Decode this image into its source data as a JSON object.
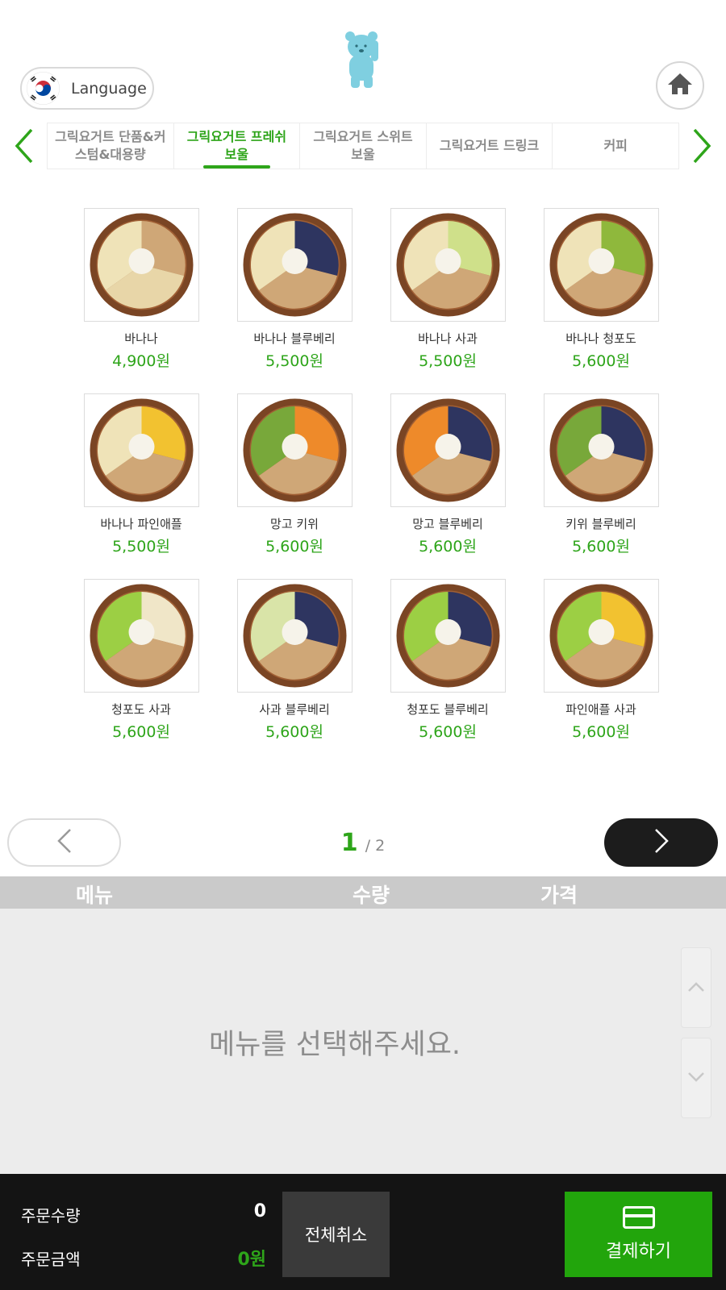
{
  "header": {
    "language_label": "Language",
    "language_flag": "korea-flag-icon",
    "logo": "bear-mascot-logo",
    "home_icon": "home-icon"
  },
  "categories": {
    "prev_icon": "chevron-left-icon",
    "next_icon": "chevron-right-icon",
    "tabs": [
      {
        "label": "그릭요거트 단품&커스텀&대용량",
        "active": false
      },
      {
        "label": "그릭요거트 프레쉬 보울",
        "active": true
      },
      {
        "label": "그릭요거트 스위트 보울",
        "active": false
      },
      {
        "label": "그릭요거트 드링크",
        "active": false
      },
      {
        "label": "커피",
        "active": false
      }
    ]
  },
  "products": [
    {
      "name": "바나나",
      "price": "4,900원"
    },
    {
      "name": "바나나 블루베리",
      "price": "5,500원"
    },
    {
      "name": "바나나 사과",
      "price": "5,500원"
    },
    {
      "name": "바나나 청포도",
      "price": "5,600원"
    },
    {
      "name": "바나나 파인애플",
      "price": "5,500원"
    },
    {
      "name": "망고 키위",
      "price": "5,600원"
    },
    {
      "name": "망고 블루베리",
      "price": "5,600원"
    },
    {
      "name": "키위 블루베리",
      "price": "5,600원"
    },
    {
      "name": "청포도 사과",
      "price": "5,600원"
    },
    {
      "name": "사과 블루베리",
      "price": "5,600원"
    },
    {
      "name": "청포도 블루베리",
      "price": "5,600원"
    },
    {
      "name": "파인애플 사과",
      "price": "5,600원"
    }
  ],
  "pagination": {
    "current": "1",
    "total": "/ 2"
  },
  "order": {
    "col_menu": "메뉴",
    "col_qty": "수량",
    "col_price": "가격",
    "empty_message": "메뉴를 선택해주세요."
  },
  "footer": {
    "qty_label": "주문수량",
    "qty_value": "0",
    "amount_label": "주문금액",
    "amount_value": "0원",
    "cancel_all": "전체취소",
    "pay": "결제하기"
  },
  "colors": {
    "accent": "#2ea51a",
    "pay_button": "#22a50c",
    "footer_bg": "#141414",
    "order_header_bg": "#cacaca",
    "logo": "#7fcfe0"
  }
}
